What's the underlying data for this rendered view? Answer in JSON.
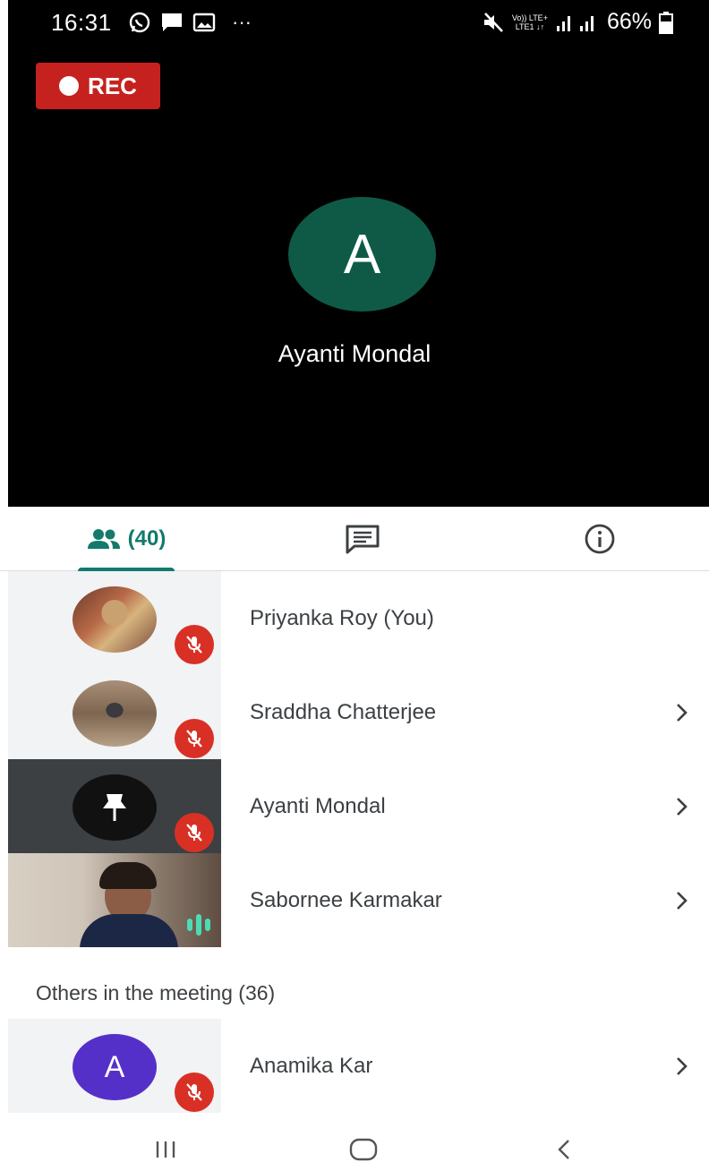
{
  "status_bar": {
    "time": "16:31",
    "network_text_top": "Vo)) LTE+",
    "network_text_bottom": "LTE1 ↓↑",
    "battery": "66%"
  },
  "recording": {
    "label": "REC"
  },
  "main_tile": {
    "avatar_letter": "A",
    "name": "Ayanti Mondal",
    "avatar_color": "#0f5a47"
  },
  "tabs": {
    "people_count": "(40)",
    "accent_color": "#137a6c"
  },
  "participants": [
    {
      "name": "Priyanka Roy (You)",
      "tile": "photo",
      "muted": true,
      "chevron": false
    },
    {
      "name": "Sraddha Chatterjee",
      "tile": "photo",
      "muted": true,
      "chevron": true
    },
    {
      "name": "Ayanti Mondal",
      "tile": "pinned",
      "muted": true,
      "chevron": true
    },
    {
      "name": "Sabornee Karmakar",
      "tile": "video",
      "muted": false,
      "speaking": true,
      "chevron": true
    }
  ],
  "others": {
    "title": "Others in the meeting (36)",
    "items": [
      {
        "name": "Anamika Kar",
        "avatar_letter": "A",
        "avatar_color": "#5530c8",
        "muted": true,
        "chevron": true
      }
    ]
  },
  "colors": {
    "mute_red": "#d93025",
    "rec_red": "#c5221f"
  }
}
